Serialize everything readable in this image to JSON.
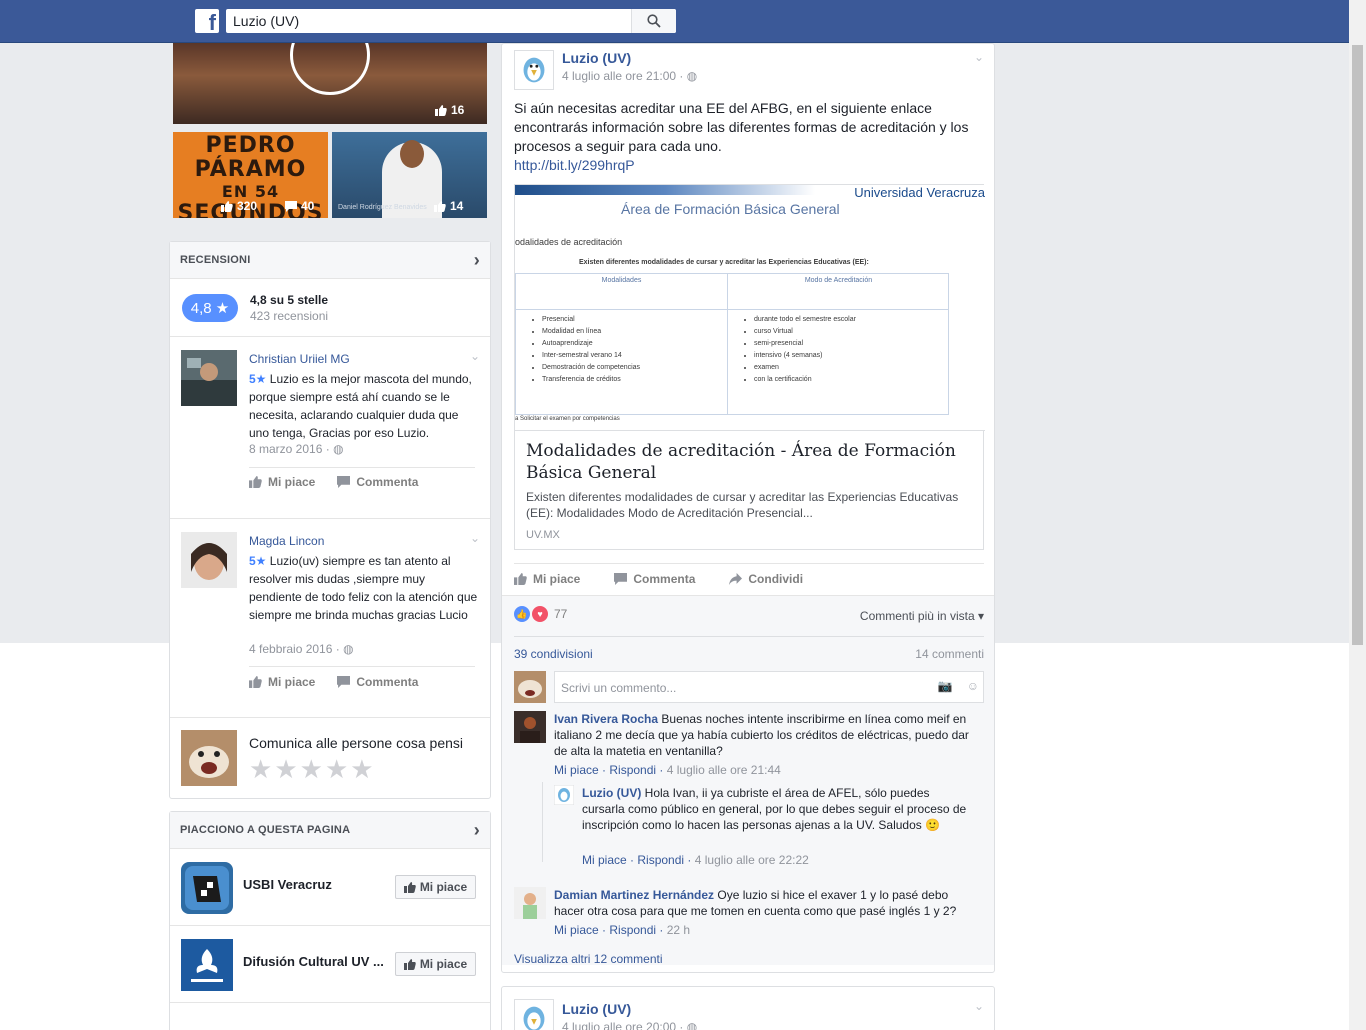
{
  "search": {
    "value": "Luzio (UV)"
  },
  "video": {
    "main_likes": "16",
    "thumb1": {
      "title_lines": [
        "PEDRO",
        "PÁRAMO",
        "EN 54",
        "SEGUNDOS"
      ],
      "likes": "320",
      "comments": "40"
    },
    "thumb2": {
      "caption": "Daniel Rodríguez Benavides",
      "likes": "14"
    }
  },
  "reviews_section": {
    "header": "RECENSIONI",
    "score": "4,8 ★",
    "summary": "4,8 su 5 stelle",
    "count": "423 recensioni",
    "items": [
      {
        "name": "Christian Uriiel MG",
        "stars": "5★",
        "text": "Luzio es la mejor mascota del mundo, porque siempre está ahí cuando se le necesita, aclarando cualquier duda que uno tenga, Gracias por eso Luzio.",
        "date": "8 marzo 2016",
        "like": "Mi piace",
        "comment": "Commenta"
      },
      {
        "name": "Magda Lincon",
        "stars": "5★",
        "text": "Luzio(uv) siempre es tan atento al resolver mis dudas ,siempre muy pendiente de todo feliz con la atención que siempre me brinda muchas gracias Lucio",
        "date": "4 febbraio 2016",
        "like": "Mi piace",
        "comment": "Commenta"
      }
    ],
    "compose_prompt": "Comunica alle persone cosa pensi"
  },
  "likes_section": {
    "header": "PIACCIONO A QUESTA PAGINA",
    "pages": [
      {
        "name": "USBI Veracruz",
        "button": "Mi piace"
      },
      {
        "name": "Difusión Cultural UV ...",
        "button": "Mi piace"
      }
    ]
  },
  "post": {
    "author": "Luzio (UV)",
    "time": "4 luglio alle ore 21:00 ·",
    "text": "Si aún necesitas acreditar una EE del AFBG, en el siguiente enlace encontrarás información sobre las diferentes formas de acreditación y los procesos a seguir para cada uno.",
    "link": "http://bit.ly/299hrqP",
    "preview": {
      "org": "Universidad Veracruza",
      "heading": "Área de Formación Básica General",
      "subheading": "odalidades de acreditación",
      "table_title": "Existen diferentes modalidades de cursar y acreditar las Experiencias Educativas (EE):",
      "col1_head": "Modalidades",
      "col2_head": "Modo de Acreditación",
      "col1_items": [
        "Presencial",
        "Modalidad en línea",
        "Autoaprendizaje",
        "Inter-semestral verano 14",
        "Demostración de competencias",
        "Transferencia de créditos"
      ],
      "col2_items": [
        "durante todo el semestre escolar",
        "curso Virtual",
        "semi-presencial",
        "intensivo (4 semanas)",
        "examen",
        "con la certificación"
      ],
      "footnote": "a Solicitar el examen por competencias"
    },
    "card_title": "Modalidades de acreditación - Área de Formación Básica General",
    "card_desc": "Existen diferentes modalidades de cursar y acreditar las Experiencias Educativas (EE): Modalidades Modo de Acreditación Presencial...",
    "card_domain": "UV.MX",
    "actions": {
      "like": "Mi piace",
      "comment": "Commenta",
      "share": "Condividi"
    },
    "reactions": "77",
    "sort": "Commenti più in vista",
    "shares": "39 condivisioni",
    "comments_count": "14 commenti",
    "comment_placeholder": "Scrivi un commento...",
    "comments": [
      {
        "name": "Ivan Rivera Rocha",
        "text": "Buenas noches intente inscribirme en línea como meif en italiano 2 me decía que ya había cubierto los créditos de eléctricas, puedo dar de alta la matetia en ventanilla?",
        "like": "Mi piace",
        "reply": "Rispondi",
        "time": "4 luglio alle ore 21:44"
      },
      {
        "name": "Luzio (UV)",
        "text": "Hola Ivan, ii ya cubriste el área de AFEL, sólo puedes cursarla como público en general, por lo que debes seguir el proceso de inscripción como lo hacen las personas ajenas a la UV. Saludos",
        "like": "Mi piace",
        "reply": "Rispondi",
        "time": "4 luglio alle ore 22:22"
      },
      {
        "name": "Damian Martinez Hernández",
        "text": "Oye luzio si hice el exaver 1 y lo pasé debo hacer otra cosa para que me tomen en cuenta como que pasé inglés 1 y 2?",
        "like": "Mi piace",
        "reply": "Rispondi",
        "time": "22 h"
      }
    ],
    "more_comments": "Visualizza altri 12 commenti"
  },
  "post2": {
    "author": "Luzio (UV)",
    "time": "4 luglio alle ore 20:00 ·"
  }
}
